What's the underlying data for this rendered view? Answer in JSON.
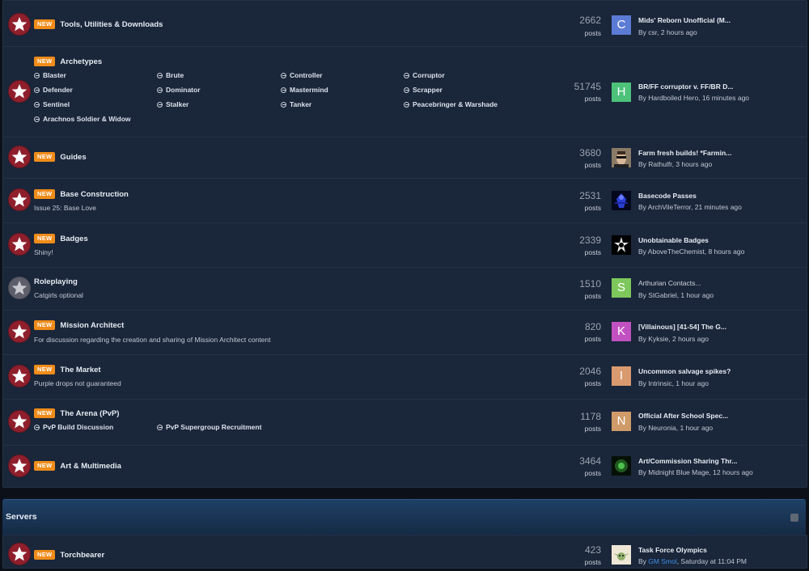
{
  "forums": [
    {
      "title": "Tools, Utilities & Downloads",
      "badge": "NEW",
      "count": "2662",
      "posts": "posts",
      "avatar": {
        "type": "letter",
        "letter": "C",
        "color": "#5b7bd5"
      },
      "last_title": "Mids' Reborn Unofficial (M...",
      "last_meta": "By csr, 2 hours ago"
    },
    {
      "title": "Archetypes",
      "badge": "NEW",
      "count": "51745",
      "posts": "posts",
      "avatar": {
        "type": "letter",
        "letter": "H",
        "color": "#4dc27a"
      },
      "last_title": "BR/FF corruptor v. FF/BR D...",
      "last_meta": "By Hardboiled Hero, 16 minutes ago",
      "subforums": [
        "Blaster",
        "Brute",
        "Controller",
        "Corruptor",
        "Defender",
        "Dominator",
        "Mastermind",
        "Scrapper",
        "Sentinel",
        "Stalker",
        "Tanker",
        "Peacebringer & Warshade",
        "Arachnos Soldier & Widow"
      ]
    },
    {
      "title": "Guides",
      "badge": "NEW",
      "count": "3680",
      "posts": "posts",
      "avatar": {
        "type": "photo",
        "name": "sunglasses-portrait"
      },
      "last_title": "Farm fresh builds! *Farmin...",
      "last_meta": "By Rathulfr, 3 hours ago"
    },
    {
      "title": "Base Construction",
      "badge": "NEW",
      "description": "Issue 25: Base Love",
      "count": "2531",
      "posts": "posts",
      "avatar": {
        "type": "photo",
        "name": "blue-hero"
      },
      "last_title": "Basecode Passes",
      "last_meta": "By ArchVileTerror, 21 minutes ago"
    },
    {
      "title": "Badges",
      "badge": "NEW",
      "description": "Shiny!",
      "count": "2339",
      "posts": "posts",
      "avatar": {
        "type": "photo",
        "name": "black-white-figure"
      },
      "last_title": "Unobtainable Badges",
      "last_meta": "By AboveTheChemist, 8 hours ago"
    },
    {
      "title": "Roleplaying",
      "description": "Catgirls optional",
      "count": "1510",
      "posts": "posts",
      "avatar": {
        "type": "letter",
        "letter": "S",
        "color": "#7ec75c"
      },
      "last_title": "Arthurian Contacts...",
      "last_meta": "By StGabriel, 1 hour ago"
    },
    {
      "title": "Mission Architect",
      "badge": "NEW",
      "description": "For discussion regarding the creation and sharing of Mission Architect content",
      "count": "820",
      "posts": "posts",
      "avatar": {
        "type": "letter",
        "letter": "K",
        "color": "#c151c1"
      },
      "last_title": "[Villainous] [41-54] The G...",
      "last_meta": "By Kyksie, 2 hours ago"
    },
    {
      "title": "The Market",
      "badge": "NEW",
      "description": "Purple drops not guaranteed",
      "count": "2046",
      "posts": "posts",
      "avatar": {
        "type": "letter",
        "letter": "I",
        "color": "#d99a70"
      },
      "last_title": "Uncommon salvage spikes?",
      "last_meta": "By Intrinsic, 1 hour ago"
    },
    {
      "title": "The Arena (PvP)",
      "badge": "NEW",
      "count": "1178",
      "posts": "posts",
      "avatar": {
        "type": "letter",
        "letter": "N",
        "color": "#cf9b68"
      },
      "last_title": "Official After School Spec...",
      "last_meta": "By Neuronia, 1 hour ago",
      "subforums": [
        "PvP Build Discussion",
        "PvP Supergroup Recruitment"
      ]
    },
    {
      "title": "Art & Multimedia",
      "badge": "NEW",
      "count": "3464",
      "posts": "posts",
      "avatar": {
        "type": "photo",
        "name": "green-creature"
      },
      "last_title": "Art/Commission Sharing Thr...",
      "last_meta": "By Midnight Blue Mage, 12 hours ago"
    }
  ],
  "servers_section": {
    "title": "Servers",
    "forums": [
      {
        "title": "Torchbearer",
        "badge": "NEW",
        "count": "423",
        "posts": "posts",
        "avatar": {
          "type": "photo",
          "name": "baby-yoda"
        },
        "last_title": "Task Force Olympics",
        "last_meta_prefix": "By ",
        "last_meta_user": "GM Smol",
        "last_meta_suffix": ", Saturday at 11:04 PM"
      }
    ]
  }
}
